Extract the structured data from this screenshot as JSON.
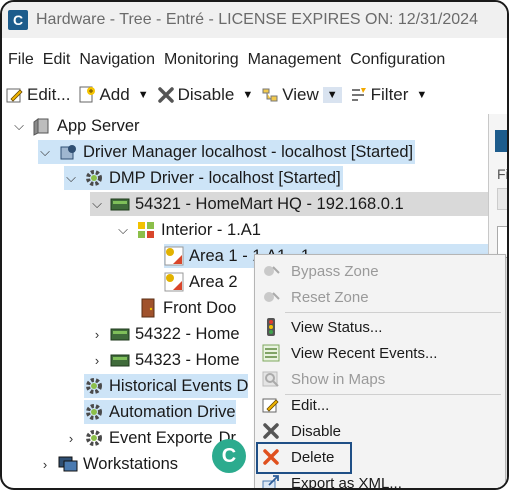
{
  "window": {
    "title": "Hardware - Tree - Entré - LICENSE EXPIRES ON: 12/31/2024",
    "app_icon_letter": "C"
  },
  "menubar": [
    "File",
    "Edit",
    "Navigation",
    "Monitoring",
    "Management",
    "Configuration"
  ],
  "toolbar": {
    "edit": "Edit...",
    "add": "Add",
    "disable": "Disable",
    "view": "View",
    "filter": "Filter"
  },
  "tree": {
    "app_server": "App Server",
    "driver_manager": "Driver Manager localhost - localhost [Started]",
    "dmp_driver": "DMP Driver - localhost [Started]",
    "panel_54321": "54321 - HomeMart HQ - 192.168.0.1",
    "interior": "Interior - 1.A1",
    "area1": "Area 1 - 1.A1 - 1",
    "area2": "Area 2",
    "front_door": "Front Doo",
    "panel_54322": "54322 - Home",
    "panel_54323": "54323 - Home",
    "historical": "Historical Events D",
    "automation": "Automation Drive",
    "event_exporter": "Event Exporte",
    "event_exporter_tail": "Dr",
    "workstations": "Workstations"
  },
  "right_pane": {
    "fi_label": "Fi"
  },
  "context_menu": {
    "bypass_zone": "Bypass Zone",
    "reset_zone": "Reset Zone",
    "view_status": "View Status...",
    "view_recent_events": "View Recent Events...",
    "show_in_maps": "Show in Maps",
    "edit": "Edit...",
    "disable": "Disable",
    "delete": "Delete",
    "export_xml": "Export as XML..."
  },
  "callout": {
    "letter": "C",
    "color": "#2cab8e"
  }
}
